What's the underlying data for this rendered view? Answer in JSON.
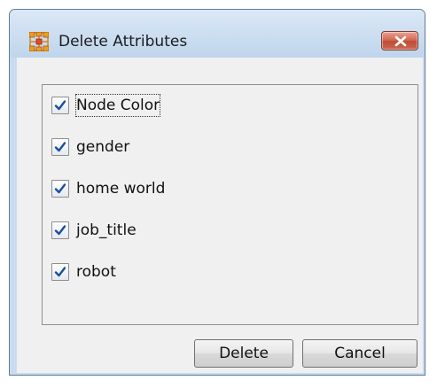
{
  "window": {
    "title": "Delete Attributes",
    "app_icon": "network-graph-icon",
    "close_icon": "close-icon",
    "close_color": "#c9503a"
  },
  "attributes": [
    {
      "label": "Node Color",
      "checked": true,
      "focused": true
    },
    {
      "label": "gender",
      "checked": true
    },
    {
      "label": "home world",
      "checked": true
    },
    {
      "label": "job_title",
      "checked": true
    },
    {
      "label": "robot",
      "checked": true
    }
  ],
  "buttons": {
    "delete_label": "Delete",
    "cancel_label": "Cancel"
  },
  "colors": {
    "check_mark": "#1c4f9c",
    "app_icon": "#e8a01a"
  }
}
